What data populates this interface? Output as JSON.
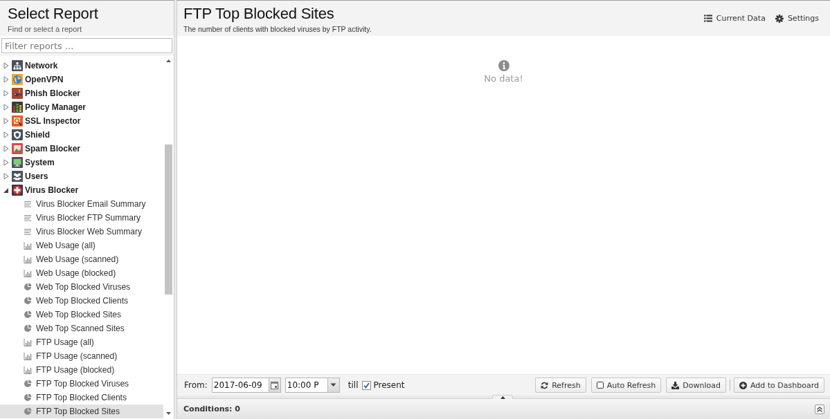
{
  "sidebar": {
    "title": "Select Report",
    "subtitle": "Find or select a report",
    "filter": {
      "placeholder": "Filter reports ..."
    },
    "tree": [
      {
        "label": "Network",
        "expanded": false,
        "selected": false
      },
      {
        "label": "OpenVPN",
        "expanded": false,
        "selected": false
      },
      {
        "label": "Phish Blocker",
        "expanded": false,
        "selected": false
      },
      {
        "label": "Policy Manager",
        "expanded": false,
        "selected": false
      },
      {
        "label": "SSL Inspector",
        "expanded": false,
        "selected": false
      },
      {
        "label": "Shield",
        "expanded": false,
        "selected": false
      },
      {
        "label": "Spam Blocker",
        "expanded": false,
        "selected": false
      },
      {
        "label": "System",
        "expanded": false,
        "selected": false
      },
      {
        "label": "Users",
        "expanded": false,
        "selected": false
      },
      {
        "label": "Virus Blocker",
        "expanded": true,
        "selected": false,
        "children": [
          {
            "label": "Virus Blocker Email Summary",
            "kind": "text",
            "selected": false
          },
          {
            "label": "Virus Blocker FTP Summary",
            "kind": "text",
            "selected": false
          },
          {
            "label": "Virus Blocker Web Summary",
            "kind": "text",
            "selected": false
          },
          {
            "label": "Web Usage (all)",
            "kind": "bar",
            "selected": false
          },
          {
            "label": "Web Usage (scanned)",
            "kind": "bar",
            "selected": false
          },
          {
            "label": "Web Usage (blocked)",
            "kind": "bar",
            "selected": false
          },
          {
            "label": "Web Top Blocked Viruses",
            "kind": "pie",
            "selected": false
          },
          {
            "label": "Web Top Blocked Clients",
            "kind": "pie",
            "selected": false
          },
          {
            "label": "Web Top Blocked Sites",
            "kind": "pie",
            "selected": false
          },
          {
            "label": "Web Top Scanned Sites",
            "kind": "pie",
            "selected": false
          },
          {
            "label": "FTP Usage (all)",
            "kind": "bar",
            "selected": false
          },
          {
            "label": "FTP Usage (scanned)",
            "kind": "bar",
            "selected": false
          },
          {
            "label": "FTP Usage (blocked)",
            "kind": "bar",
            "selected": false
          },
          {
            "label": "FTP Top Blocked Viruses",
            "kind": "pie",
            "selected": false
          },
          {
            "label": "FTP Top Blocked Clients",
            "kind": "pie",
            "selected": false
          },
          {
            "label": "FTP Top Blocked Sites",
            "kind": "pie",
            "selected": true
          }
        ]
      }
    ]
  },
  "report": {
    "title": "FTP Top Blocked Sites",
    "description": "The number of clients with blocked viruses by FTP activity.",
    "actions": [
      {
        "label": "Current Data",
        "kind": "list"
      },
      {
        "label": "Settings",
        "kind": "gear"
      }
    ],
    "empty_message": "No data!"
  },
  "toolbar": {
    "from_label": "From:",
    "date": "2017-06-09",
    "time": "10:00 P",
    "till_label": "till",
    "present": {
      "label": "Present",
      "checked": true
    },
    "refresh": {
      "label": "Refresh"
    },
    "auto_refresh": {
      "label": "Auto Refresh",
      "on": false
    },
    "download": {
      "label": "Download"
    },
    "add_to_dashboard": {
      "label": "Add to Dashboard"
    }
  },
  "conditions": {
    "label": "Conditions: 0"
  }
}
